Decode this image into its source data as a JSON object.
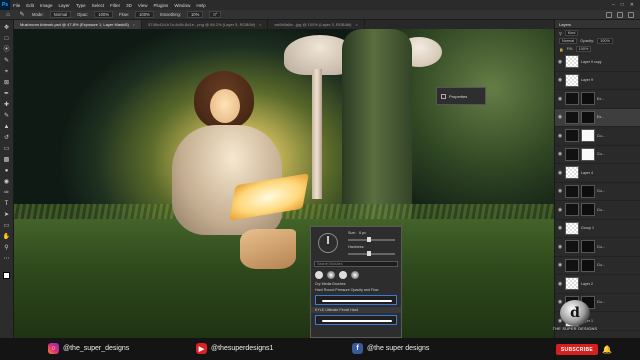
{
  "app": {
    "logo": "Ps",
    "menu": [
      "File",
      "Edit",
      "Image",
      "Layer",
      "Type",
      "Select",
      "Filter",
      "3D",
      "View",
      "Plugins",
      "Window",
      "Help"
    ]
  },
  "options_bar": {
    "mode_label": "Mode:",
    "mode_value": "Normal",
    "opacity_label": "Opac:",
    "opacity_value": "100%",
    "flow_label": "Flow:",
    "flow_value": "100%",
    "smoothing_label": "Smoothing:",
    "smoothing_value": "10%",
    "angle_value": "0°"
  },
  "tabs": [
    {
      "label": "Mushroom Artwork.psd @ 47.8% (Exposure 1, Layer Mask/8)",
      "active": true
    },
    {
      "label": "5745c42d-b7a-4c8b-8d1e...png @ 66.2% (Layer 5, RGB/8#)",
      "active": false
    },
    {
      "label": "ws5b5a8e...jpg @ 100% (Layer 3, RGB/8#)",
      "active": false
    }
  ],
  "properties_panel": {
    "title": "Properties"
  },
  "brush_popup": {
    "size_label": "Size:",
    "size_value": "8 px",
    "hardness_label": "Hardness:",
    "search_placeholder": "Search Brushes",
    "items": [
      "Dry Media Brushes",
      "Hard Round Pressure Opacity and Flow",
      "KYLE Ultimate Pencil Hard"
    ]
  },
  "layers_panel": {
    "tab_label": "Layers",
    "kind_label": "Kind",
    "blend_value": "Normal",
    "opacity_label": "Opacity:",
    "opacity_value": "100%",
    "fill_label": "Fill:",
    "fill_value": "100%",
    "layers": [
      {
        "name": "Layer 9 copy",
        "thumb": "checker",
        "mask": null,
        "selected": false
      },
      {
        "name": "Layer 9",
        "thumb": "checker",
        "mask": null,
        "selected": false
      },
      {
        "name": "Ex...",
        "thumb": "dark",
        "mask": "dark",
        "selected": false
      },
      {
        "name": "Ex...",
        "thumb": "dark",
        "mask": "dark",
        "selected": true
      },
      {
        "name": "Cu...",
        "thumb": "dark",
        "mask": "white",
        "selected": false
      },
      {
        "name": "Cu...",
        "thumb": "dark",
        "mask": "white",
        "selected": false
      },
      {
        "name": "Layer 4",
        "thumb": "checker",
        "mask": null,
        "selected": false
      },
      {
        "name": "Cu...",
        "thumb": "dark",
        "mask": "dark",
        "selected": false
      },
      {
        "name": "Cu...",
        "thumb": "dark",
        "mask": "dark",
        "selected": false
      },
      {
        "name": "Group 1",
        "thumb": "checker",
        "mask": null,
        "selected": false
      },
      {
        "name": "Cu...",
        "thumb": "dark",
        "mask": "dark",
        "selected": false
      },
      {
        "name": "Cu...",
        "thumb": "dark",
        "mask": "dark",
        "selected": false
      },
      {
        "name": "Layer 2",
        "thumb": "checker",
        "mask": null,
        "selected": false
      },
      {
        "name": "Cu...",
        "thumb": "dark",
        "mask": "dark",
        "selected": false
      },
      {
        "name": "Layer 1",
        "thumb": "checker",
        "mask": null,
        "selected": false
      }
    ]
  },
  "social": {
    "instagram": "@the_super_designs",
    "youtube": "@thesuperdesigns1",
    "facebook": "@the super designs",
    "subscribe": "SUBSCRIBE"
  },
  "watermark": {
    "mark": "d",
    "text": "THE SUPER DESIGNS"
  },
  "colors": {
    "ps_blue": "#31a8ff",
    "subscribe_red": "#d61f1f",
    "panel_bg": "#2a2a2a"
  }
}
